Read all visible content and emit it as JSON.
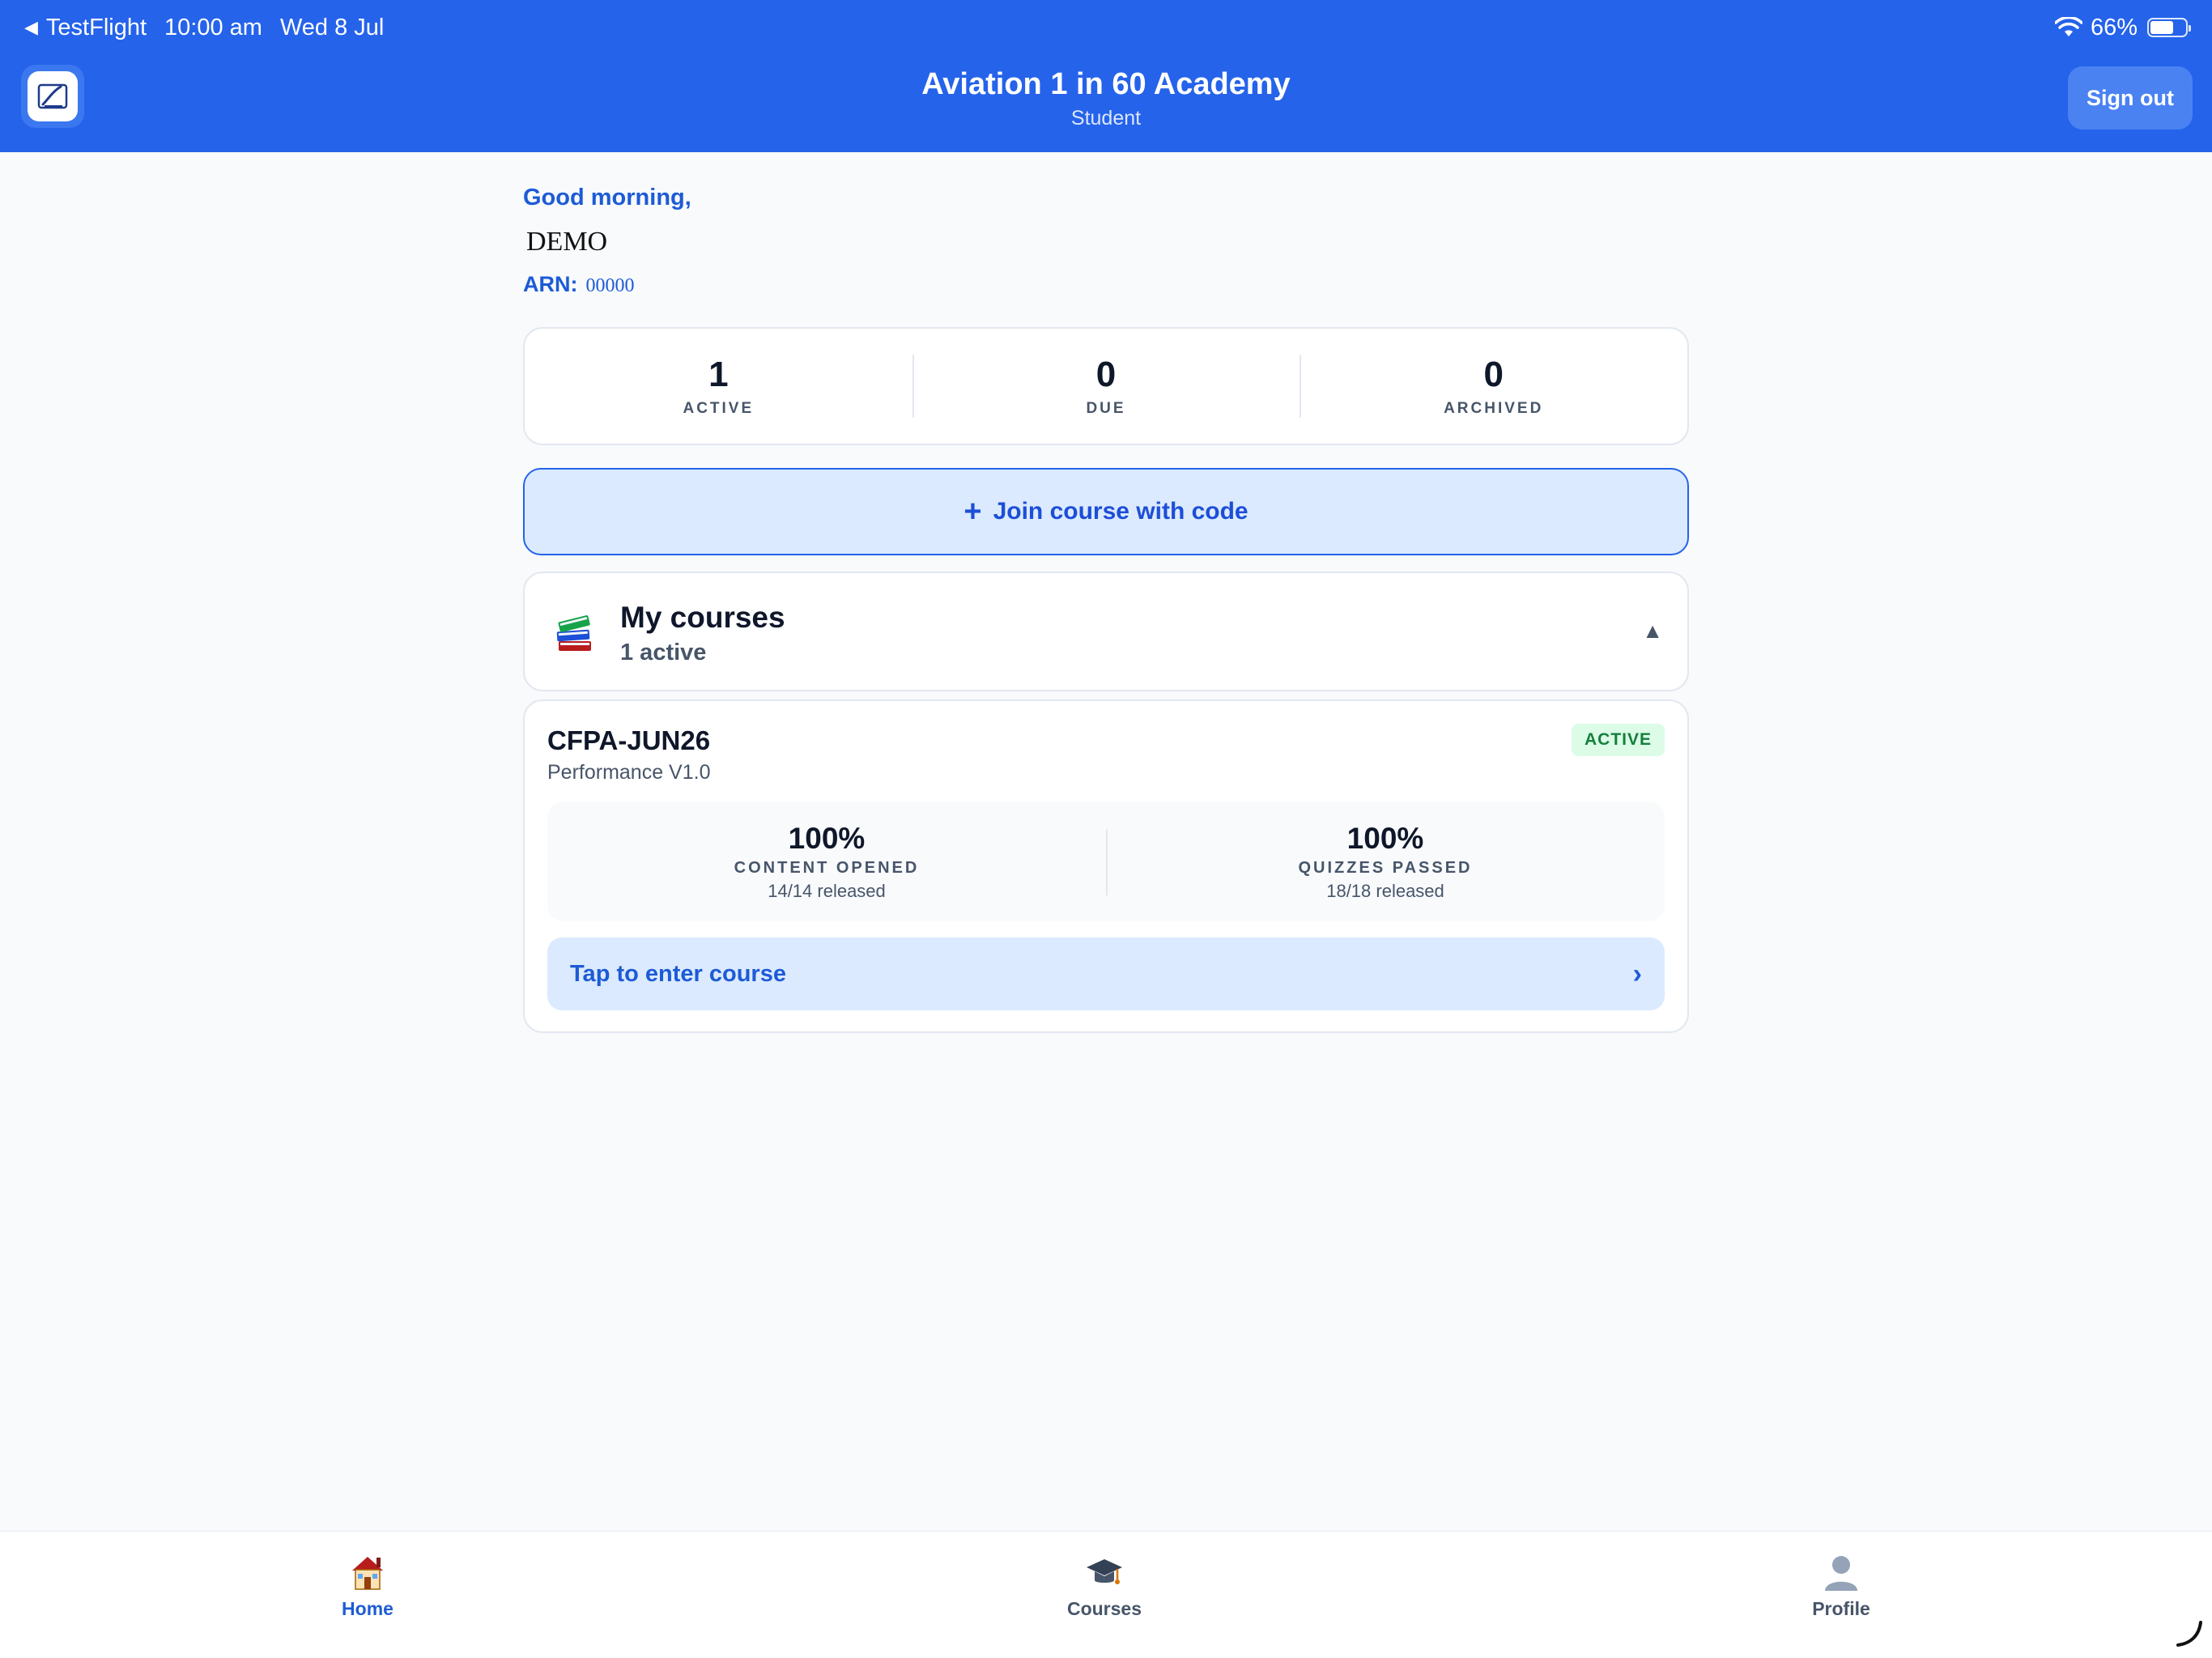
{
  "status_bar": {
    "back_app": "TestFlight",
    "time": "10:00 am",
    "date": "Wed 8 Jul",
    "battery": "66%",
    "battery_level": 0.66
  },
  "header": {
    "title": "Aviation 1 in 60 Academy",
    "subtitle": "Student",
    "sign_out_label": "Sign out"
  },
  "greeting": {
    "salutation": "Good morning,",
    "name": "DEMO",
    "arn_label": "ARN:",
    "arn_value": "00000"
  },
  "stats": [
    {
      "value": "1",
      "label": "ACTIVE"
    },
    {
      "value": "0",
      "label": "DUE"
    },
    {
      "value": "0",
      "label": "ARCHIVED"
    }
  ],
  "join": {
    "icon": "+",
    "label": "Join course with code"
  },
  "my_courses": {
    "icon": "books-icon",
    "title": "My courses",
    "subtitle": "1 active",
    "toggle": "▲"
  },
  "course": {
    "code": "CFPA-JUN26",
    "name": "Performance V1.0",
    "status": "ACTIVE",
    "progress": [
      {
        "percent": "100%",
        "label": "CONTENT OPENED",
        "released": "14/14 released"
      },
      {
        "percent": "100%",
        "label": "QUIZZES PASSED",
        "released": "18/18 released"
      }
    ],
    "enter_label": "Tap to enter course",
    "enter_chevron": "›"
  },
  "tabs": [
    {
      "label": "Home",
      "icon": "house-icon",
      "active": true
    },
    {
      "label": "Courses",
      "icon": "graduation-cap-icon",
      "active": false
    },
    {
      "label": "Profile",
      "icon": "person-icon",
      "active": false
    }
  ],
  "colors": {
    "brand": "#2563eb",
    "accent_text": "#1d5bd6",
    "active_badge_bg": "#dcfce7",
    "active_badge_text": "#15803d"
  }
}
